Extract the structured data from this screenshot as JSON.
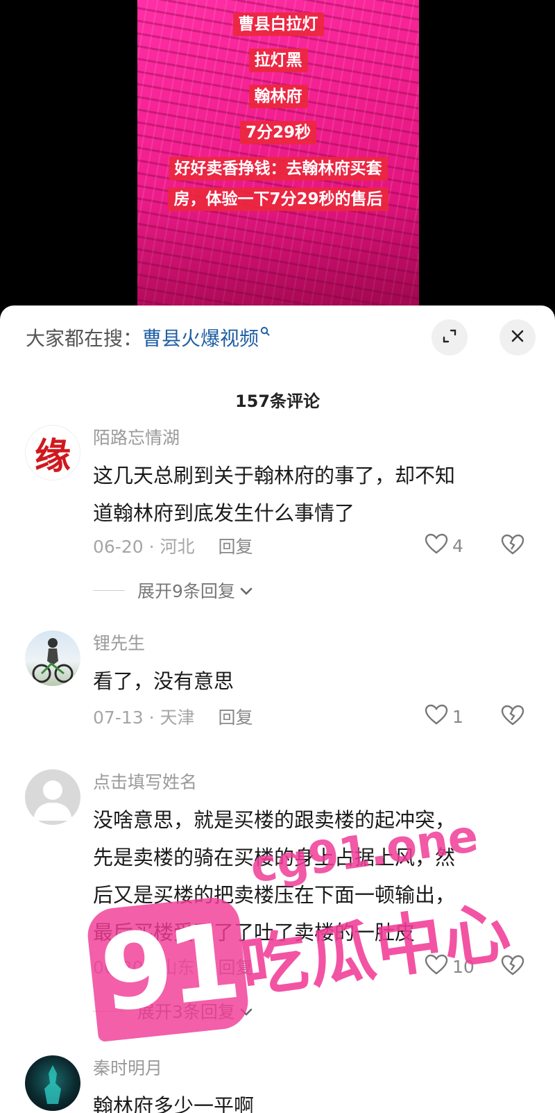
{
  "video": {
    "captions": [
      "曹县白拉灯",
      "拉灯黑",
      "翰林府",
      "7分29秒",
      "好好卖香挣钱：去翰林府买套",
      "房，体验一下7分29秒的售后"
    ]
  },
  "sheet": {
    "search_prefix": "大家都在搜：",
    "search_term": "曹县火爆视频",
    "comment_count": "157条评论"
  },
  "comments": [
    {
      "user": "陌路忘情湖",
      "avatar_text": "缘",
      "lines": [
        "这几天总刷到关于翰林府的事了，却不知",
        "道翰林府到底发生什么事情了"
      ],
      "date_location": "06-20 · 河北",
      "reply_label": "回复",
      "likes": "4",
      "expand_label": "展开9条回复"
    },
    {
      "user": "锂先生",
      "lines": [
        "看了，没有意思"
      ],
      "date_location": "07-13 · 天津",
      "reply_label": "回复",
      "likes": "1"
    },
    {
      "user": "点击填写姓名",
      "lines": [
        "没啥意思，就是买楼的跟卖楼的起冲突，",
        "先是卖楼的骑在买楼的身上占据上风，然",
        "后又是买楼的把卖楼压在下面一顿输出，",
        "最后买楼受不了了吐了卖楼的一肚皮"
      ],
      "date_location": "06-20 · 山东",
      "reply_label": "回复",
      "likes": "10",
      "expand_label": "展开3条回复"
    },
    {
      "user": "秦时明月",
      "lines": [
        "翰林府多少一平啊"
      ]
    }
  ],
  "watermark": {
    "badge": "91",
    "domain": "cg91.one",
    "slogan": "吃瓜中心"
  },
  "colors": {
    "video_pink": "#f21f8f",
    "caption_red": "#eb283c",
    "link_blue": "#1f5fa3",
    "watermark_pink": "#f03c96"
  },
  "icons": [
    "search-icon",
    "expand-icon",
    "close-icon",
    "heart-icon",
    "broken-heart-icon",
    "chevron-down-icon"
  ]
}
